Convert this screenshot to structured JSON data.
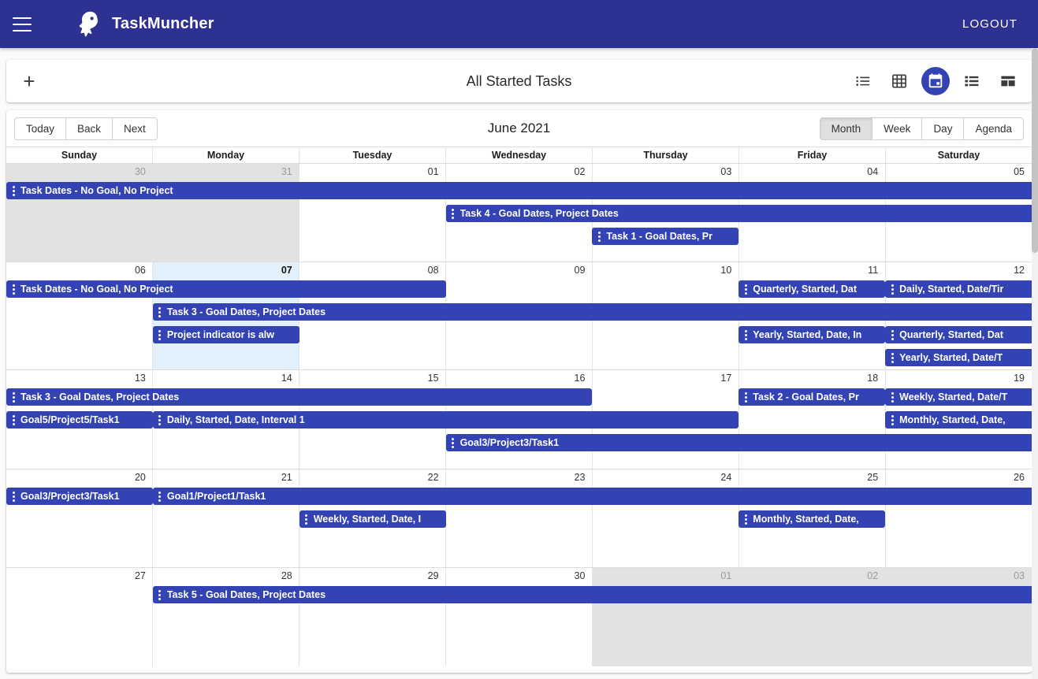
{
  "appbar": {
    "menu_icon": "hamburger-menu-icon",
    "logo_icon": "taskmuncher-bird-logo",
    "title": "TaskMuncher",
    "logout_label": "LOGOUT",
    "background_color": "#2d3292"
  },
  "toolbar": {
    "add_label": "+",
    "title": "All Started Tasks",
    "view_icons": [
      {
        "name": "list-view-icon",
        "glyph": "list",
        "active": false
      },
      {
        "name": "grid-view-icon",
        "glyph": "grid",
        "active": false
      },
      {
        "name": "calendar-view-icon",
        "glyph": "calendar",
        "active": true
      },
      {
        "name": "detail-list-view-icon",
        "glyph": "detail-list",
        "active": false
      },
      {
        "name": "board-view-icon",
        "glyph": "board",
        "active": false
      }
    ],
    "active_accent": "#3443b4"
  },
  "calendar": {
    "nav_buttons": [
      {
        "label": "Today",
        "selected": false
      },
      {
        "label": "Back",
        "selected": false
      },
      {
        "label": "Next",
        "selected": false
      }
    ],
    "label": "June 2021",
    "view_buttons": [
      {
        "label": "Month",
        "selected": true
      },
      {
        "label": "Week",
        "selected": false
      },
      {
        "label": "Day",
        "selected": false
      },
      {
        "label": "Agenda",
        "selected": false
      }
    ],
    "day_headers": [
      "Sunday",
      "Monday",
      "Tuesday",
      "Wednesday",
      "Thursday",
      "Friday",
      "Saturday"
    ],
    "event_color": "#3443b4",
    "today_cell_color": "#e2f0fb",
    "off_month_cell_color": "#e2e2e2",
    "weeks": [
      {
        "days": [
          {
            "num": "30",
            "off": true,
            "today": false
          },
          {
            "num": "31",
            "off": true,
            "today": false
          },
          {
            "num": "01",
            "off": false,
            "today": false
          },
          {
            "num": "02",
            "off": false,
            "today": false
          },
          {
            "num": "03",
            "off": false,
            "today": false
          },
          {
            "num": "04",
            "off": false,
            "today": false
          },
          {
            "num": "05",
            "off": false,
            "today": false
          }
        ],
        "events": [
          {
            "title": "Task Dates - No Goal, No Project",
            "start": 0,
            "span": 7,
            "row": 0,
            "bleed_right": true
          },
          {
            "title": "Task 4 - Goal Dates, Project Dates",
            "start": 3,
            "span": 4,
            "row": 1,
            "bleed_right": true
          },
          {
            "title": "Task 1 - Goal Dates, Pr",
            "start": 4,
            "span": 1,
            "row": 2,
            "bleed_right": false
          }
        ]
      },
      {
        "days": [
          {
            "num": "06",
            "off": false,
            "today": false
          },
          {
            "num": "07",
            "off": false,
            "today": true
          },
          {
            "num": "08",
            "off": false,
            "today": false
          },
          {
            "num": "09",
            "off": false,
            "today": false
          },
          {
            "num": "10",
            "off": false,
            "today": false
          },
          {
            "num": "11",
            "off": false,
            "today": false
          },
          {
            "num": "12",
            "off": false,
            "today": false
          }
        ],
        "events": [
          {
            "title": "Task Dates - No Goal, No Project",
            "start": 0,
            "span": 3,
            "row": 0,
            "bleed_right": false
          },
          {
            "title": "Quarterly, Started, Dat",
            "start": 5,
            "span": 1,
            "row": 0,
            "bleed_right": false
          },
          {
            "title": "Daily, Started, Date/Tir",
            "start": 6,
            "span": 1,
            "row": 0,
            "bleed_right": true
          },
          {
            "title": "Task 3 - Goal Dates, Project Dates",
            "start": 1,
            "span": 6,
            "row": 1,
            "bleed_right": true
          },
          {
            "title": "Project indicator is alw",
            "start": 1,
            "span": 1,
            "row": 2,
            "bleed_right": false
          },
          {
            "title": "Yearly, Started, Date, In",
            "start": 5,
            "span": 1,
            "row": 2,
            "bleed_right": false
          },
          {
            "title": "Quarterly, Started, Dat",
            "start": 6,
            "span": 1,
            "row": 2,
            "bleed_right": true
          },
          {
            "title": "Yearly, Started, Date/T",
            "start": 6,
            "span": 1,
            "row": 3,
            "bleed_right": true
          }
        ]
      },
      {
        "days": [
          {
            "num": "13",
            "off": false,
            "today": false
          },
          {
            "num": "14",
            "off": false,
            "today": false
          },
          {
            "num": "15",
            "off": false,
            "today": false
          },
          {
            "num": "16",
            "off": false,
            "today": false
          },
          {
            "num": "17",
            "off": false,
            "today": false
          },
          {
            "num": "18",
            "off": false,
            "today": false
          },
          {
            "num": "19",
            "off": false,
            "today": false
          }
        ],
        "events": [
          {
            "title": "Task 3 - Goal Dates, Project Dates",
            "start": 0,
            "span": 4,
            "row": 0,
            "bleed_right": false
          },
          {
            "title": "Task 2 - Goal Dates, Pr",
            "start": 5,
            "span": 1,
            "row": 0,
            "bleed_right": false
          },
          {
            "title": "Weekly, Started, Date/T",
            "start": 6,
            "span": 1,
            "row": 0,
            "bleed_right": true
          },
          {
            "title": "Goal5/Project5/Task1",
            "start": 0,
            "span": 1,
            "row": 1,
            "bleed_right": false
          },
          {
            "title": "Daily, Started, Date, Interval 1",
            "start": 1,
            "span": 4,
            "row": 1,
            "bleed_right": false
          },
          {
            "title": "Monthly, Started, Date,",
            "start": 6,
            "span": 1,
            "row": 1,
            "bleed_right": true
          },
          {
            "title": "Goal3/Project3/Task1",
            "start": 3,
            "span": 4,
            "row": 2,
            "bleed_right": true
          }
        ]
      },
      {
        "days": [
          {
            "num": "20",
            "off": false,
            "today": false
          },
          {
            "num": "21",
            "off": false,
            "today": false
          },
          {
            "num": "22",
            "off": false,
            "today": false
          },
          {
            "num": "23",
            "off": false,
            "today": false
          },
          {
            "num": "24",
            "off": false,
            "today": false
          },
          {
            "num": "25",
            "off": false,
            "today": false
          },
          {
            "num": "26",
            "off": false,
            "today": false
          }
        ],
        "events": [
          {
            "title": "Goal3/Project3/Task1",
            "start": 0,
            "span": 1,
            "row": 0,
            "bleed_right": false
          },
          {
            "title": "Goal1/Project1/Task1",
            "start": 1,
            "span": 6,
            "row": 0,
            "bleed_right": true
          },
          {
            "title": "Weekly, Started, Date, I",
            "start": 2,
            "span": 1,
            "row": 1,
            "bleed_right": false
          },
          {
            "title": "Monthly, Started, Date,",
            "start": 5,
            "span": 1,
            "row": 1,
            "bleed_right": false
          }
        ]
      },
      {
        "days": [
          {
            "num": "27",
            "off": false,
            "today": false
          },
          {
            "num": "28",
            "off": false,
            "today": false
          },
          {
            "num": "29",
            "off": false,
            "today": false
          },
          {
            "num": "30",
            "off": false,
            "today": false
          },
          {
            "num": "01",
            "off": true,
            "today": false
          },
          {
            "num": "02",
            "off": true,
            "today": false
          },
          {
            "num": "03",
            "off": true,
            "today": false
          }
        ],
        "events": [
          {
            "title": "Task 5 - Goal Dates, Project Dates",
            "start": 1,
            "span": 6,
            "row": 0,
            "bleed_right": true
          }
        ]
      }
    ]
  }
}
